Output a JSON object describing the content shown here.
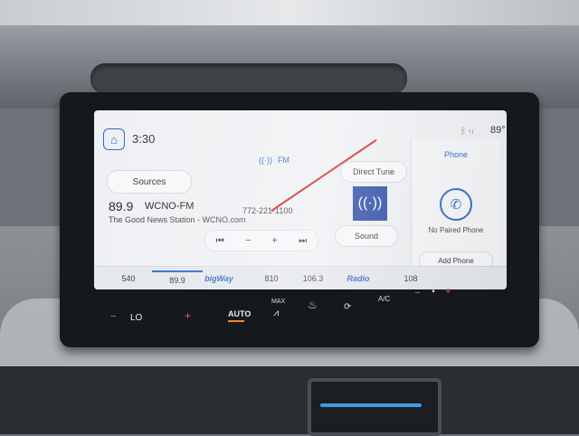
{
  "status": {
    "time": "3:30",
    "temperature": "89°"
  },
  "radio": {
    "band": "FM",
    "frequency": "89.9",
    "call_sign": "WCNO-FM",
    "station_info": "The Good News Station - WCNO.com",
    "phone": "772-221-1100",
    "sources_label": "Sources",
    "direct_tune_label": "Direct Tune",
    "sound_label": "Sound",
    "controls": [
      "⏮",
      "−",
      "+",
      "⏭"
    ]
  },
  "presets": [
    {
      "label": "540"
    },
    {
      "label": "89.9",
      "active": true
    },
    {
      "label": "bigWay",
      "logo": true
    },
    {
      "label": "810"
    },
    {
      "label": "106.3"
    },
    {
      "label": "Radio",
      "logo": true
    },
    {
      "label": "108"
    }
  ],
  "phone_panel": {
    "title": "Phone",
    "no_paired": "No Paired Phone",
    "add_phone": "Add Phone"
  },
  "climate": {
    "temp_label": "LO",
    "auto_label": "AUTO",
    "max_label": "MAX",
    "ac_label": "A/C"
  },
  "colors": {
    "accent": "#2f66c7",
    "artwork": "#2a49a6"
  }
}
